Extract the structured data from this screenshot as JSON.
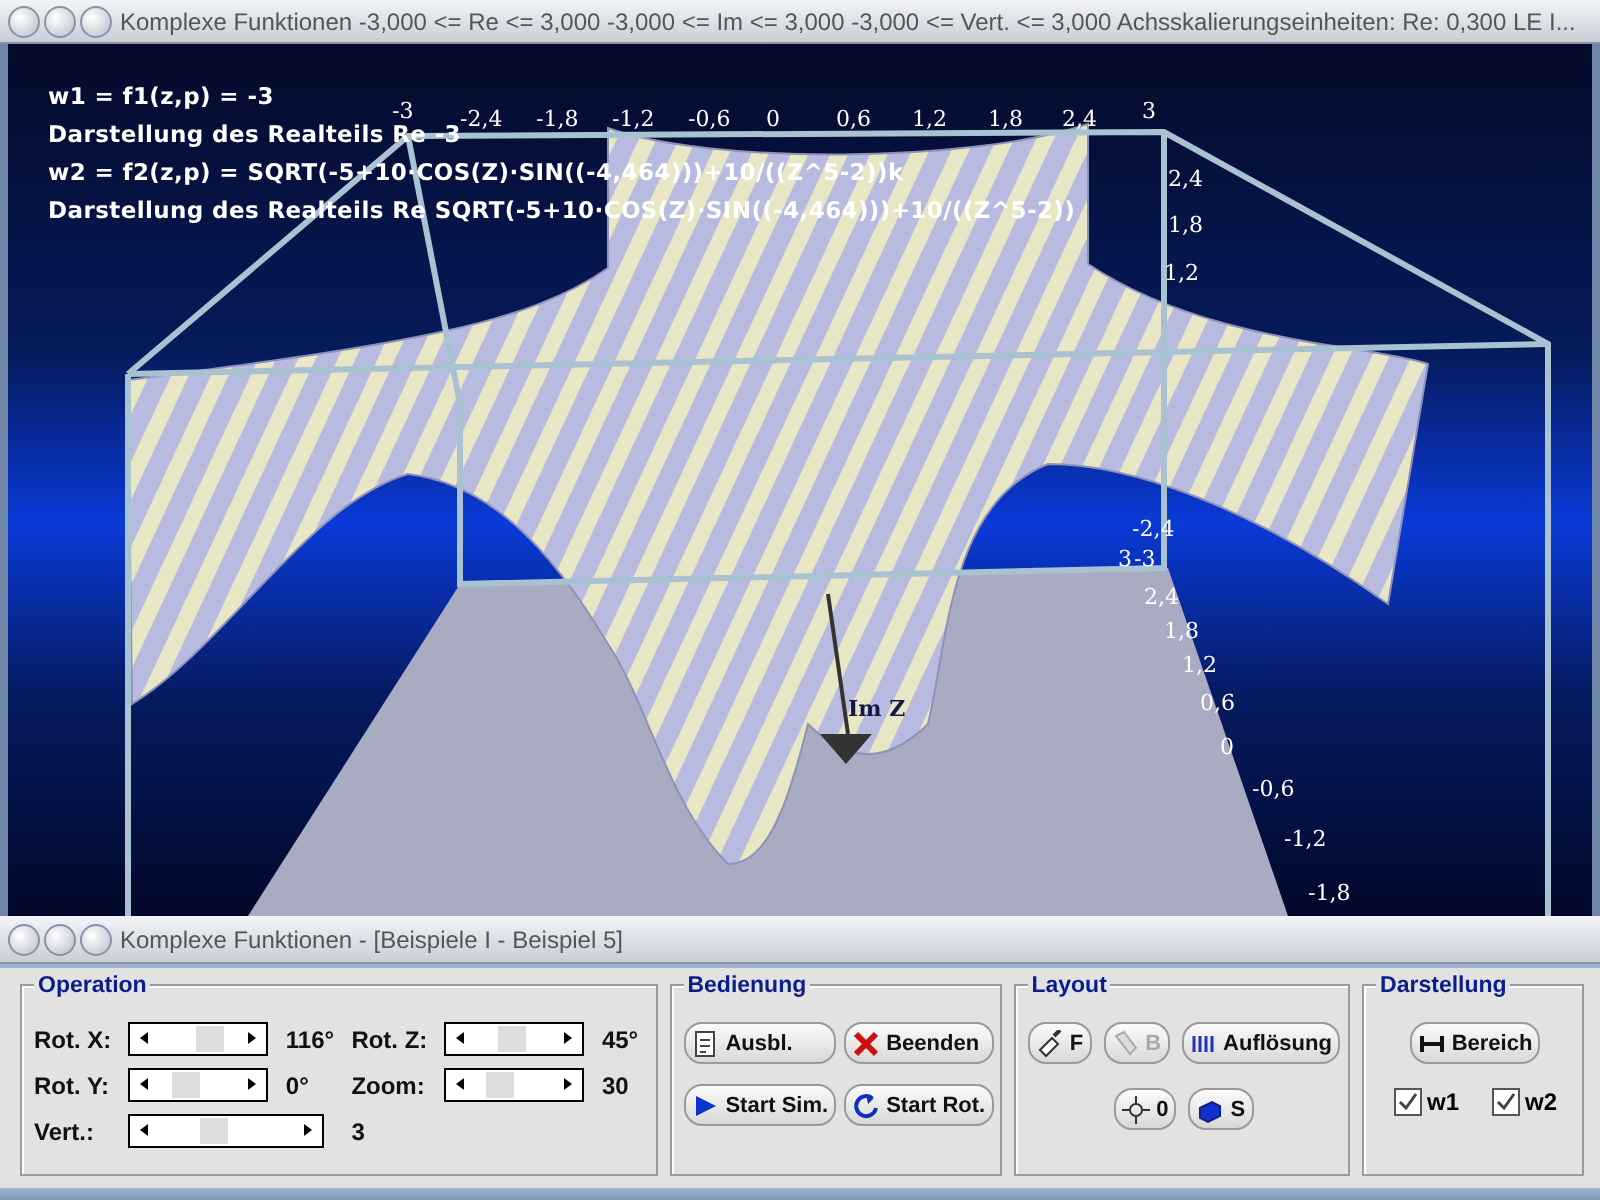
{
  "window": {
    "title": "Komplexe Funktionen   -3,000 <= Re <= 3,000   -3,000 <= Im <= 3,000   -3,000 <= Vert. <= 3,000   Achsskalierungseinheiten:  Re: 0,300 LE   I..."
  },
  "plot": {
    "info_lines": [
      "w1 = f1(z,p) = -3",
      "Darstellung des Realteils Re -3",
      "w2 = f2(z,p) = SQRT(-5+10·COS(Z)·SIN((-4,464)))+10/((Z^5-2))k",
      "Darstellung des Realteils Re SQRT(-5+10·COS(Z)·SIN((-4,464)))+10/((Z^5-2))"
    ],
    "top_ticks": [
      "-3",
      "-2,4",
      "-1,8",
      "-1,2",
      "-0,6",
      "0",
      "0,6",
      "1,2",
      "1,8",
      "2,4",
      "3"
    ],
    "right_upper_ticks": [
      "2,4",
      "1,8",
      "1,2"
    ],
    "right_lower_ticks": [
      "-2,4",
      "3",
      "-3",
      "2,4",
      "1,8",
      "1,2",
      "0,6",
      "0",
      "-0,6",
      "-1,2",
      "-1,8"
    ],
    "axis_label": "Im Z"
  },
  "control_window": {
    "title": "Komplexe Funktionen - [Beispiele I - Beispiel 5]"
  },
  "operation": {
    "title": "Operation",
    "sliders": [
      {
        "label": "Rot. X:",
        "level": 0.6,
        "reading": "116°"
      },
      {
        "label": "Rot. Z:",
        "level": 0.5,
        "reading": "45°"
      },
      {
        "label": "Rot. Y:",
        "level": 0.42,
        "reading": "0°"
      },
      {
        "label": "Zoom:",
        "level": 0.4,
        "reading": "30"
      },
      {
        "label": "Vert.:",
        "level": 0.45,
        "reading": "3"
      }
    ]
  },
  "bedienung": {
    "title": "Bedienung",
    "buttons": [
      {
        "label": "Ausbl."
      },
      {
        "label": "Beenden"
      },
      {
        "label": "Start Sim."
      },
      {
        "label": "Start Rot."
      }
    ]
  },
  "layout": {
    "title": "Layout",
    "buttons": [
      {
        "label": "F",
        "disabled": false
      },
      {
        "label": "B",
        "disabled": true
      },
      {
        "label": "Auflösung",
        "disabled": false
      },
      {
        "label": "0",
        "disabled": false
      },
      {
        "label": "S",
        "disabled": false
      }
    ]
  },
  "darstellung": {
    "title": "Darstellung",
    "button": "Bereich",
    "checkboxes": [
      {
        "label": "w1",
        "checked": true
      },
      {
        "label": "w2",
        "checked": true
      }
    ]
  }
}
